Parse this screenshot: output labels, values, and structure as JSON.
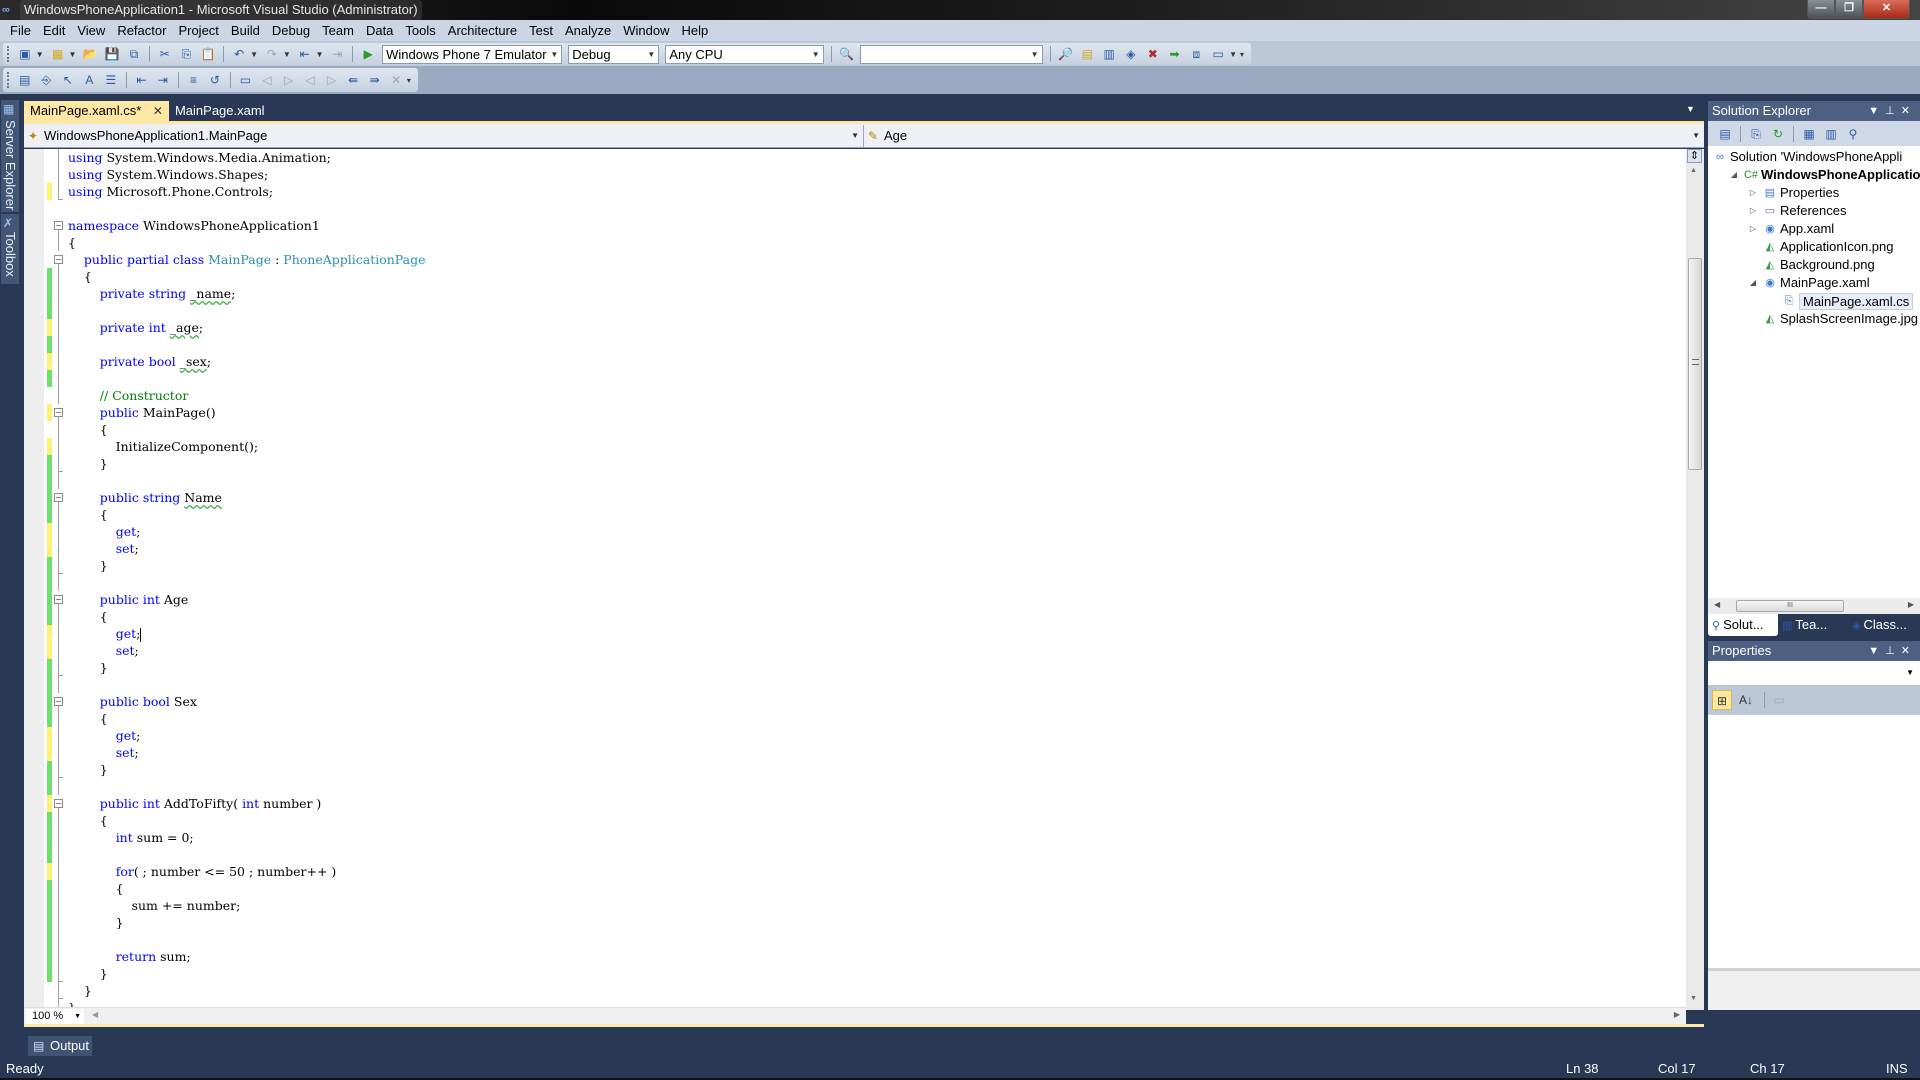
{
  "window": {
    "title": "WindowsPhoneApplication1 - Microsoft Visual Studio (Administrator)",
    "controls": {
      "minimize": "—",
      "restore": "❐",
      "close": "✕"
    }
  },
  "menu": [
    "File",
    "Edit",
    "View",
    "Refactor",
    "Project",
    "Build",
    "Debug",
    "Team",
    "Data",
    "Tools",
    "Architecture",
    "Test",
    "Analyze",
    "Window",
    "Help"
  ],
  "toolbar": {
    "target_device": "Windows Phone 7 Emulator",
    "configuration": "Debug",
    "platform": "Any CPU",
    "find_box": ""
  },
  "side_tabs": {
    "server_explorer": "Server Explorer",
    "toolbox": "Toolbox"
  },
  "doc_tabs": [
    {
      "label": "MainPage.xaml.cs*",
      "active": true,
      "close": "✕"
    },
    {
      "label": "MainPage.xaml",
      "active": false
    }
  ],
  "navbar": {
    "type_combo": "WindowsPhoneApplication1.MainPage",
    "member_combo": "Age"
  },
  "editor": {
    "zoom": "100 %",
    "lines": [
      {
        "change": "none",
        "fold": "line",
        "html": "<span class='kw'>using</span> System.Windows.Media.Animation;"
      },
      {
        "change": "none",
        "fold": "line",
        "html": "<span class='kw'>using</span> System.Windows.Shapes;"
      },
      {
        "change": "unsaved",
        "fold": "end",
        "html": "<span class='kw'>using</span> Microsoft.Phone.Controls;"
      },
      {
        "change": "none",
        "fold": "none",
        "html": ""
      },
      {
        "change": "none",
        "fold": "box",
        "html": "<span class='kw'>namespace</span> WindowsPhoneApplication1"
      },
      {
        "change": "none",
        "fold": "line",
        "html": "{"
      },
      {
        "change": "none",
        "fold": "box",
        "html": "    <span class='kw'>public</span> <span class='kw'>partial</span> <span class='kw'>class</span> <span class='ty'>MainPage</span> : <span class='ty'>PhoneApplicationPage</span>"
      },
      {
        "change": "saved",
        "fold": "line",
        "html": "    {"
      },
      {
        "change": "saved",
        "fold": "line",
        "html": "        <span class='kw'>private</span> <span class='kw'>string</span> <span class='sq'>_name</span>;"
      },
      {
        "change": "saved",
        "fold": "line",
        "html": ""
      },
      {
        "change": "unsaved",
        "fold": "line",
        "html": "        <span class='kw'>private</span> <span class='kw'>int</span> <span class='sq'>_age</span>;"
      },
      {
        "change": "saved",
        "fold": "line",
        "html": ""
      },
      {
        "change": "unsaved",
        "fold": "line",
        "html": "        <span class='kw'>private</span> <span class='kw'>bool</span> <span class='sq'>_sex</span>;"
      },
      {
        "change": "saved",
        "fold": "line",
        "html": ""
      },
      {
        "change": "none",
        "fold": "line",
        "html": "        <span class='cm'>// Constructor</span>"
      },
      {
        "change": "unsaved",
        "fold": "box",
        "html": "        <span class='kw'>public</span> MainPage()"
      },
      {
        "change": "none",
        "fold": "line",
        "html": "        {"
      },
      {
        "change": "unsaved",
        "fold": "line",
        "html": "            InitializeComponent();"
      },
      {
        "change": "saved",
        "fold": "end",
        "html": "        }"
      },
      {
        "change": "saved",
        "fold": "line",
        "html": ""
      },
      {
        "change": "saved",
        "fold": "box",
        "html": "        <span class='kw'>public</span> <span class='kw'>string</span> <span class='sq'>Name</span>"
      },
      {
        "change": "saved",
        "fold": "line",
        "html": "        {"
      },
      {
        "change": "unsaved",
        "fold": "line",
        "html": "            <span class='kw'>get</span>;"
      },
      {
        "change": "unsaved",
        "fold": "line",
        "html": "            <span class='kw'>set</span>;"
      },
      {
        "change": "saved",
        "fold": "end",
        "html": "        }"
      },
      {
        "change": "saved",
        "fold": "line",
        "html": ""
      },
      {
        "change": "saved",
        "fold": "box",
        "html": "        <span class='kw'>public</span> <span class='kw'>int</span> Age"
      },
      {
        "change": "saved",
        "fold": "line",
        "html": "        {"
      },
      {
        "change": "unsaved",
        "fold": "line",
        "html": "            <span class='kw'>get</span>;<span class='caret'></span>"
      },
      {
        "change": "unsaved",
        "fold": "line",
        "html": "            <span class='kw'>set</span>;"
      },
      {
        "change": "saved",
        "fold": "end",
        "html": "        }"
      },
      {
        "change": "saved",
        "fold": "line",
        "html": ""
      },
      {
        "change": "saved",
        "fold": "box",
        "html": "        <span class='kw'>public</span> <span class='kw'>bool</span> Sex"
      },
      {
        "change": "saved",
        "fold": "line",
        "html": "        {"
      },
      {
        "change": "unsaved",
        "fold": "line",
        "html": "            <span class='kw'>get</span>;"
      },
      {
        "change": "unsaved",
        "fold": "line",
        "html": "            <span class='kw'>set</span>;"
      },
      {
        "change": "saved",
        "fold": "end",
        "html": "        }"
      },
      {
        "change": "saved",
        "fold": "line",
        "html": ""
      },
      {
        "change": "unsaved",
        "fold": "box",
        "html": "        <span class='kw'>public</span> <span class='kw'>int</span> AddToFifty( <span class='kw'>int</span> number )"
      },
      {
        "change": "saved",
        "fold": "line",
        "html": "        {"
      },
      {
        "change": "saved",
        "fold": "line",
        "html": "            <span class='kw'>int</span> sum = 0;"
      },
      {
        "change": "saved",
        "fold": "line",
        "html": ""
      },
      {
        "change": "unsaved",
        "fold": "line",
        "html": "            <span class='kw'>for</span>( ; number &lt;= 50 ; number++ )"
      },
      {
        "change": "saved",
        "fold": "line",
        "html": "            {"
      },
      {
        "change": "saved",
        "fold": "line",
        "html": "                sum += number;"
      },
      {
        "change": "saved",
        "fold": "line",
        "html": "            }"
      },
      {
        "change": "saved",
        "fold": "line",
        "html": ""
      },
      {
        "change": "saved",
        "fold": "line",
        "html": "            <span class='kw'>return</span> sum;"
      },
      {
        "change": "saved",
        "fold": "end",
        "html": "        }"
      },
      {
        "change": "none",
        "fold": "end",
        "html": "    }"
      },
      {
        "change": "none",
        "fold": "end",
        "html": "}"
      }
    ]
  },
  "output_tab": "Output",
  "status": {
    "text": "Ready",
    "line": "Ln 38",
    "col": "Col 17",
    "ch": "Ch 17",
    "mode": "INS"
  },
  "solution_explorer": {
    "title": "Solution Explorer",
    "items": [
      {
        "label": "Solution 'WindowsPhoneAppli",
        "indent": 0,
        "expander": "",
        "icon": "solution-icon",
        "glyph": "∞",
        "color": "#3a6fc4"
      },
      {
        "label": "WindowsPhoneApplicatio",
        "indent": 1,
        "expander": "◢",
        "icon": "csharp-project-icon",
        "glyph": "C#",
        "color": "#2a8a2a",
        "bold": true
      },
      {
        "label": "Properties",
        "indent": 2,
        "expander": "▷",
        "icon": "properties-folder-icon",
        "glyph": "▤",
        "color": "#4a7ec8"
      },
      {
        "label": "References",
        "indent": 2,
        "expander": "▷",
        "icon": "references-folder-icon",
        "glyph": "▭",
        "color": "#6a7c98"
      },
      {
        "label": "App.xaml",
        "indent": 2,
        "expander": "▷",
        "icon": "xaml-file-icon",
        "glyph": "◉",
        "color": "#3a7ad8"
      },
      {
        "label": "ApplicationIcon.png",
        "indent": 2,
        "expander": "",
        "icon": "image-file-icon",
        "glyph": "◭",
        "color": "#3a9a4a"
      },
      {
        "label": "Background.png",
        "indent": 2,
        "expander": "",
        "icon": "image-file-icon",
        "glyph": "◭",
        "color": "#3a9a4a"
      },
      {
        "label": "MainPage.xaml",
        "indent": 2,
        "expander": "◢",
        "icon": "xaml-file-icon",
        "glyph": "◉",
        "color": "#3a7ad8"
      },
      {
        "label": "MainPage.xaml.cs",
        "indent": 3,
        "expander": "",
        "icon": "cs-file-icon",
        "glyph": "⎘",
        "color": "#3a7ad8",
        "selected": true
      },
      {
        "label": "SplashScreenImage.jpg",
        "indent": 2,
        "expander": "",
        "icon": "image-file-icon",
        "glyph": "◭",
        "color": "#3a9a4a"
      }
    ],
    "tabs": [
      "Solut...",
      "Tea...",
      "Class..."
    ]
  },
  "properties": {
    "title": "Properties",
    "object_combo": ""
  }
}
